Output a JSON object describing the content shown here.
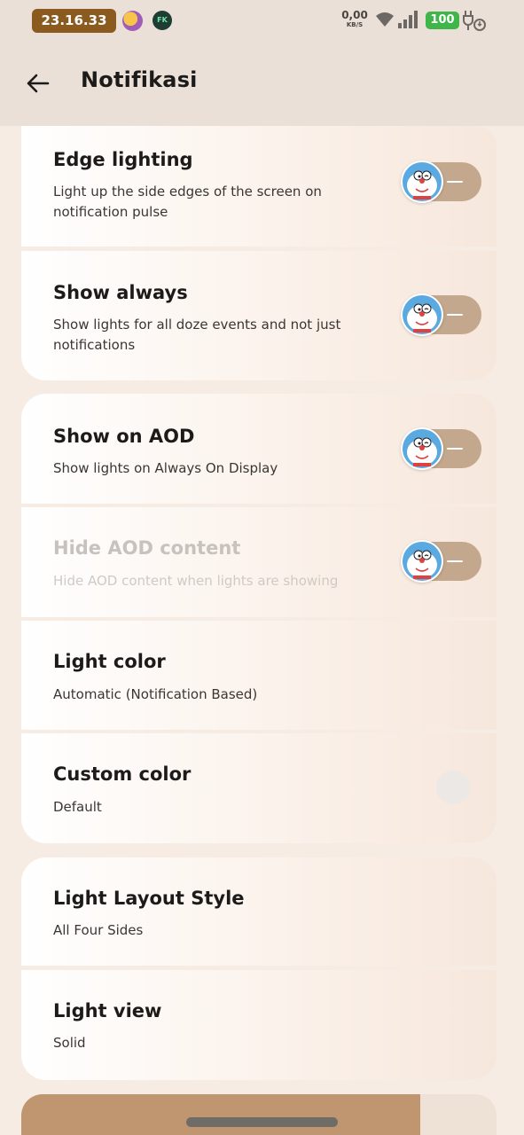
{
  "status_bar": {
    "time": "23.16.33",
    "net_speed_value": "0,00",
    "net_speed_unit": "KB/S",
    "battery": "100",
    "avatar2_text": "FK"
  },
  "app_bar": {
    "title": "Notifikasi"
  },
  "settings": [
    {
      "title": "Edge lighting",
      "subtitle": "Light up the side edges of the screen on notification pulse",
      "toggle_on": false,
      "enabled": true
    },
    {
      "title": "Show always",
      "subtitle": "Show lights for all doze events and not just notifications",
      "toggle_on": false,
      "enabled": true
    },
    {
      "title": "Show on AOD",
      "subtitle": "Show lights on Always On Display",
      "toggle_on": false,
      "enabled": true
    },
    {
      "title": "Hide AOD content",
      "subtitle": "Hide AOD content when lights are showing",
      "toggle_on": false,
      "enabled": false
    },
    {
      "title": "Light color",
      "subtitle": "Automatic (Notification Based)"
    },
    {
      "title": "Custom color",
      "subtitle": "Default"
    },
    {
      "title": "Light Layout Style",
      "subtitle": "All Four Sides"
    },
    {
      "title": "Light view",
      "subtitle": "Solid"
    }
  ],
  "bottom_strip": {
    "progress": 0.84
  },
  "colors": {
    "accent": "#c4a88d",
    "time_pill": "#8b5a1f",
    "battery": "#3fb54a",
    "background": "#f7ece3"
  }
}
